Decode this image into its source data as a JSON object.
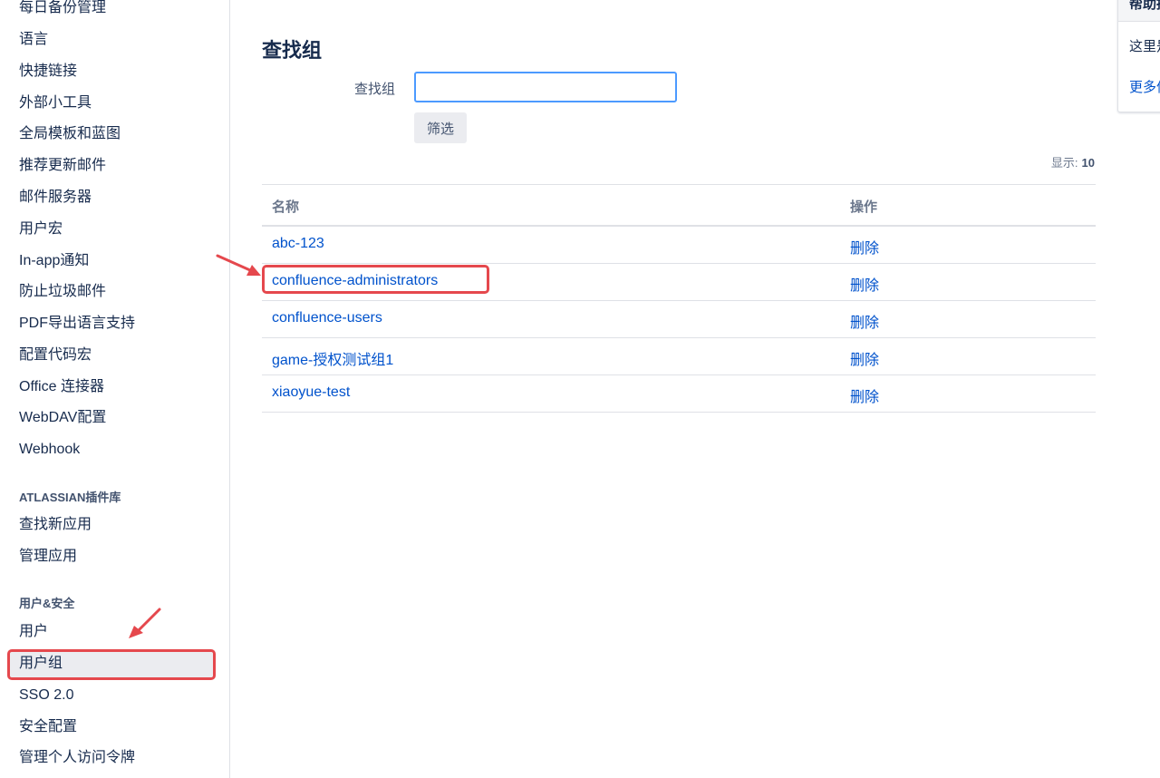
{
  "sidebar": {
    "items_top": [
      {
        "label": "每日备份管理"
      },
      {
        "label": "语言"
      },
      {
        "label": "快捷链接"
      },
      {
        "label": "外部小工具"
      },
      {
        "label": "全局模板和蓝图"
      },
      {
        "label": "推荐更新邮件"
      },
      {
        "label": "邮件服务器"
      },
      {
        "label": "用户宏"
      },
      {
        "label": "In-app通知"
      },
      {
        "label": "防止垃圾邮件"
      },
      {
        "label": "PDF导出语言支持"
      },
      {
        "label": "配置代码宏"
      },
      {
        "label": "Office 连接器"
      },
      {
        "label": "WebDAV配置"
      },
      {
        "label": "Webhook"
      }
    ],
    "marketplace_heading": "ATLASSIAN插件库",
    "marketplace_items": [
      {
        "label": "查找新应用"
      },
      {
        "label": "管理应用"
      }
    ],
    "security_heading": "用户&安全",
    "security_items": [
      {
        "label": "用户"
      },
      {
        "label": "用户组"
      },
      {
        "label": "SSO 2.0"
      },
      {
        "label": "安全配置"
      },
      {
        "label": "管理个人访问令牌"
      }
    ]
  },
  "main": {
    "title": "查找组",
    "search_label": "查找组",
    "search_value": "",
    "filter_button": "筛选",
    "show_label": "显示:",
    "show_count": "10",
    "table": {
      "headers": {
        "name": "名称",
        "action": "操作"
      },
      "rows": [
        {
          "name": "abc-123",
          "action": "删除"
        },
        {
          "name": "confluence-administrators",
          "action": "删除"
        },
        {
          "name": "confluence-users",
          "action": "删除"
        },
        {
          "name": "game-授权测试组1",
          "action": "删除"
        },
        {
          "name": "xiaoyue-test",
          "action": "删除"
        }
      ]
    }
  },
  "help": {
    "title": "帮助提示",
    "text": "这里是",
    "more": "更多信息"
  },
  "colors": {
    "accent": "#0052cc",
    "annotation": "#e5484d"
  }
}
